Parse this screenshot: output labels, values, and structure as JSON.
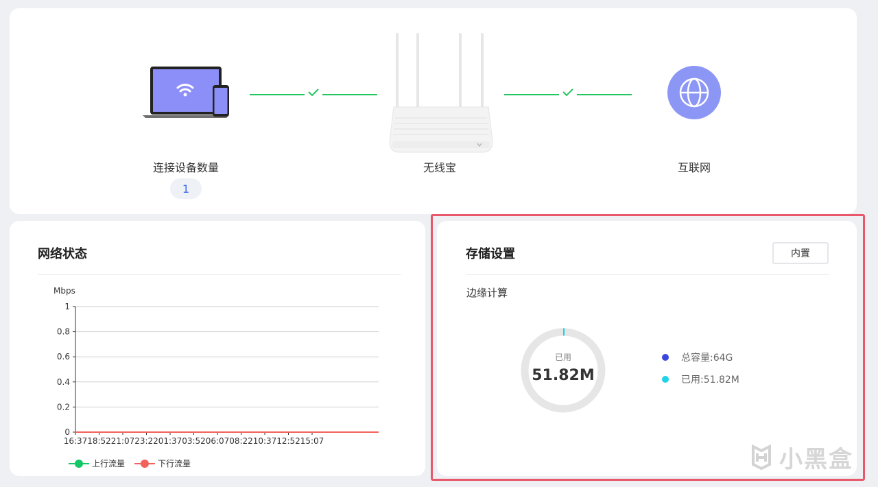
{
  "topology": {
    "devices_label": "连接设备数量",
    "devices_count": "1",
    "router_label": "无线宝",
    "internet_label": "互联网"
  },
  "network": {
    "title": "网络状态",
    "unit": "Mbps",
    "legend": [
      "上行流量",
      "下行流量"
    ],
    "colors": {
      "upload": "#12c766",
      "download": "#f0625a"
    }
  },
  "chart_data": {
    "type": "line",
    "x": [
      "16:37",
      "18:52",
      "21:07",
      "23:22",
      "01:37",
      "03:52",
      "06:07",
      "08:22",
      "10:37",
      "12:52",
      "15:07"
    ],
    "series": [
      {
        "name": "上行流量",
        "values": [
          0,
          0,
          0,
          0,
          0,
          0,
          0,
          0,
          0,
          0,
          0
        ]
      },
      {
        "name": "下行流量",
        "values": [
          0,
          0,
          0,
          0,
          0,
          0,
          0,
          0,
          0,
          0,
          0
        ]
      }
    ],
    "ylabel": "Mbps",
    "ylim": [
      0,
      1
    ],
    "yticks": [
      "0",
      "0.2",
      "0.4",
      "0.6",
      "0.8",
      "1"
    ],
    "grid": true,
    "legend_position": "bottom-left"
  },
  "storage": {
    "title": "存储设置",
    "button_label": "内置",
    "section_label": "边缘计算",
    "used_label": "已用",
    "used_value": "51.82M",
    "used_fraction": 0.0008,
    "legend_total": "总容量:64G",
    "legend_used": "已用:51.82M",
    "colors": {
      "total": "#3b46e0",
      "used": "#1fd3e8",
      "track": "#e6e6e6"
    }
  },
  "watermark": {
    "text": "小黑盒"
  }
}
